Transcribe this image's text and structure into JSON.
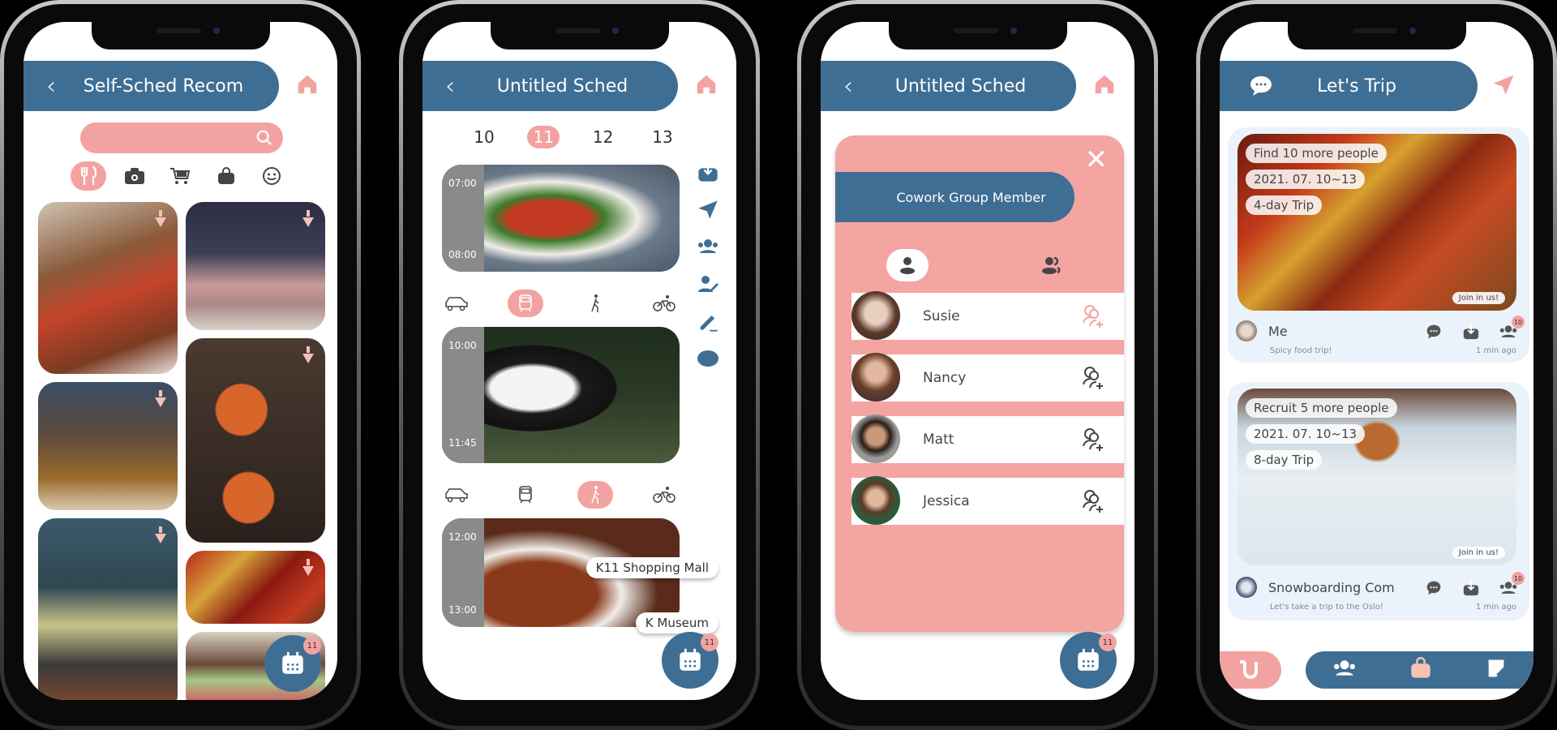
{
  "colors": {
    "primary": "#3f6e94",
    "accent": "#f2a3a1",
    "card_bg": "#eaf3fb"
  },
  "screen1": {
    "header": {
      "back_icon": "chevron-left-icon",
      "title": "Self-Sched Recom",
      "home_icon": "home-icon"
    },
    "search": {
      "placeholder": "",
      "icon": "search-icon"
    },
    "categories": [
      {
        "icon": "fork-knife-icon",
        "active": true
      },
      {
        "icon": "camera-icon",
        "active": false
      },
      {
        "icon": "cart-icon",
        "active": false
      },
      {
        "icon": "bag-icon",
        "active": false
      },
      {
        "icon": "smiley-icon",
        "active": false
      }
    ],
    "tiles": [
      "mapo-tofu-dinner",
      "hotpot-meat-platter",
      "hotpot-steam",
      "red-lanterns",
      "bean-sprouts-wok",
      "spicy-hotpot",
      "hotpot-spread"
    ],
    "fab": {
      "icon": "calendar-icon",
      "badge": "11"
    }
  },
  "screen2": {
    "header": {
      "back_icon": "chevron-left-icon",
      "title": "Untitled Sched",
      "home_icon": "home-icon"
    },
    "dates": [
      "10",
      "11",
      "12",
      "13"
    ],
    "selected_date": "11",
    "events": [
      {
        "start": "07:00",
        "end": "08:00",
        "image": "noodle-bowl",
        "transport_selected": "train"
      },
      {
        "start": "10:00",
        "end": "11:45",
        "image": "panda",
        "transport_selected": "walk"
      },
      {
        "start": "12:00",
        "end": "13:00",
        "image": "mapo-tofu",
        "tags": [
          "K11 Shopping Mall",
          "K Museum"
        ]
      }
    ],
    "transport_modes": [
      "car",
      "train",
      "walk",
      "bike"
    ],
    "side_tools": [
      "download-icon",
      "send-icon",
      "group-icon",
      "edit-user-icon",
      "pen-icon",
      "pill-shape-icon"
    ],
    "fab": {
      "icon": "calendar-icon",
      "badge": "11"
    }
  },
  "screen3": {
    "header": {
      "back_icon": "chevron-left-icon",
      "title": "Untitled Sched",
      "home_icon": "home-icon"
    },
    "modal": {
      "title": "Cowork Group Member",
      "close_icon": "close-icon",
      "tabs": [
        {
          "icon": "single-user-icon",
          "active": true
        },
        {
          "icon": "multi-user-icon",
          "active": false
        }
      ],
      "members": [
        {
          "name": "Susie",
          "highlight": true
        },
        {
          "name": "Nancy",
          "highlight": false
        },
        {
          "name": "Matt",
          "highlight": false
        },
        {
          "name": "Jessica",
          "highlight": false
        }
      ]
    },
    "fab": {
      "icon": "calendar-icon",
      "badge": "11"
    }
  },
  "screen4": {
    "header": {
      "chat_icon": "chat-bubble-icon",
      "title": "Let's Trip",
      "send_icon": "send-icon"
    },
    "posts": [
      {
        "pills": [
          "Find 10 more people",
          "2021. 07. 10~13",
          "4-day Trip"
        ],
        "join_label": "Join in us!",
        "owner": "Me",
        "caption": "Spicy food trip!",
        "time": "1 min ago",
        "member_count": "10",
        "image": "spicy-hotpot"
      },
      {
        "pills": [
          "Recruit 5 more people",
          "2021. 07. 10~13",
          "8-day Trip"
        ],
        "join_label": "Join in us!",
        "owner": "Snowboarding Com",
        "caption": "Let's take a trip to the Oslo!",
        "time": "1 min ago",
        "member_count": "10",
        "image": "snowboarder"
      }
    ],
    "bottom_nav": [
      "logo-u-icon",
      "friends-icon",
      "bag-icon",
      "note-edit-icon"
    ]
  }
}
